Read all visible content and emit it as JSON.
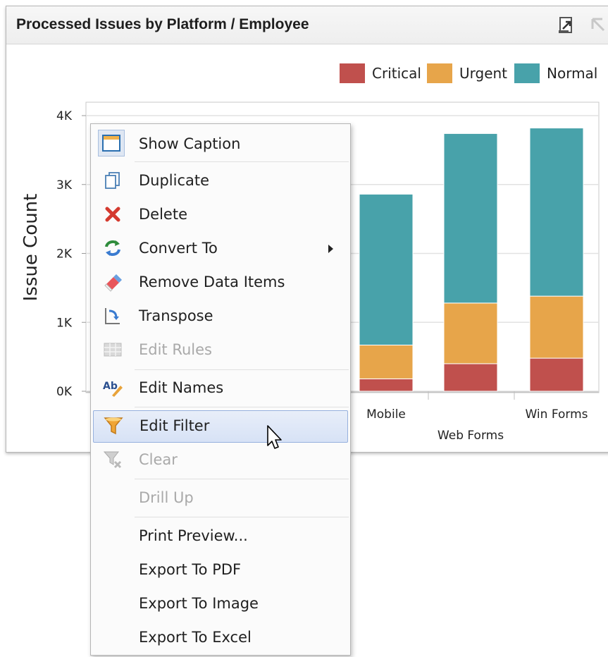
{
  "panel": {
    "title": "Processed Issues by Platform / Employee",
    "header_icons": [
      "export-icon",
      "drill-up-icon"
    ]
  },
  "chart_data": {
    "type": "bar",
    "stacked": true,
    "ylabel": "Issue Count",
    "y_ticks": [
      "0K",
      "1K",
      "2K",
      "3K",
      "4K"
    ],
    "ylim": [
      0,
      4000
    ],
    "categories": [
      "Mobile",
      "Web Forms",
      "Win Forms"
    ],
    "series": [
      {
        "name": "Critical",
        "color": "#c0504d",
        "values": [
          180,
          400,
          480
        ]
      },
      {
        "name": "Urgent",
        "color": "#e7a54a",
        "values": [
          490,
          880,
          900
        ]
      },
      {
        "name": "Normal",
        "color": "#48a2aa",
        "values": [
          2190,
          2460,
          2440
        ]
      }
    ],
    "legend_position": "top-right",
    "grid": true
  },
  "menu": {
    "items": [
      {
        "label": "Show Caption",
        "icon": "caption-icon",
        "enabled": true
      },
      {
        "label": "Duplicate",
        "icon": "duplicate-icon",
        "enabled": true
      },
      {
        "label": "Delete",
        "icon": "delete-icon",
        "enabled": true
      },
      {
        "label": "Convert To",
        "icon": "convert-icon",
        "enabled": true,
        "submenu": true
      },
      {
        "label": "Remove Data Items",
        "icon": "eraser-icon",
        "enabled": true
      },
      {
        "label": "Transpose",
        "icon": "transpose-icon",
        "enabled": true
      },
      {
        "label": "Edit Rules",
        "icon": "grid-icon",
        "enabled": false
      },
      {
        "label": "Edit Names",
        "icon": "edit-names-icon",
        "enabled": true
      },
      {
        "label": "Edit Filter",
        "icon": "filter-icon",
        "enabled": true,
        "highlighted": true
      },
      {
        "label": "Clear",
        "icon": "clear-filter-icon",
        "enabled": false
      },
      {
        "label": "Drill Up",
        "icon": "",
        "enabled": false
      },
      {
        "label": "Print Preview...",
        "icon": "",
        "enabled": true
      },
      {
        "label": "Export To PDF",
        "icon": "",
        "enabled": true
      },
      {
        "label": "Export To Image",
        "icon": "",
        "enabled": true
      },
      {
        "label": "Export To Excel",
        "icon": "",
        "enabled": true
      }
    ]
  }
}
